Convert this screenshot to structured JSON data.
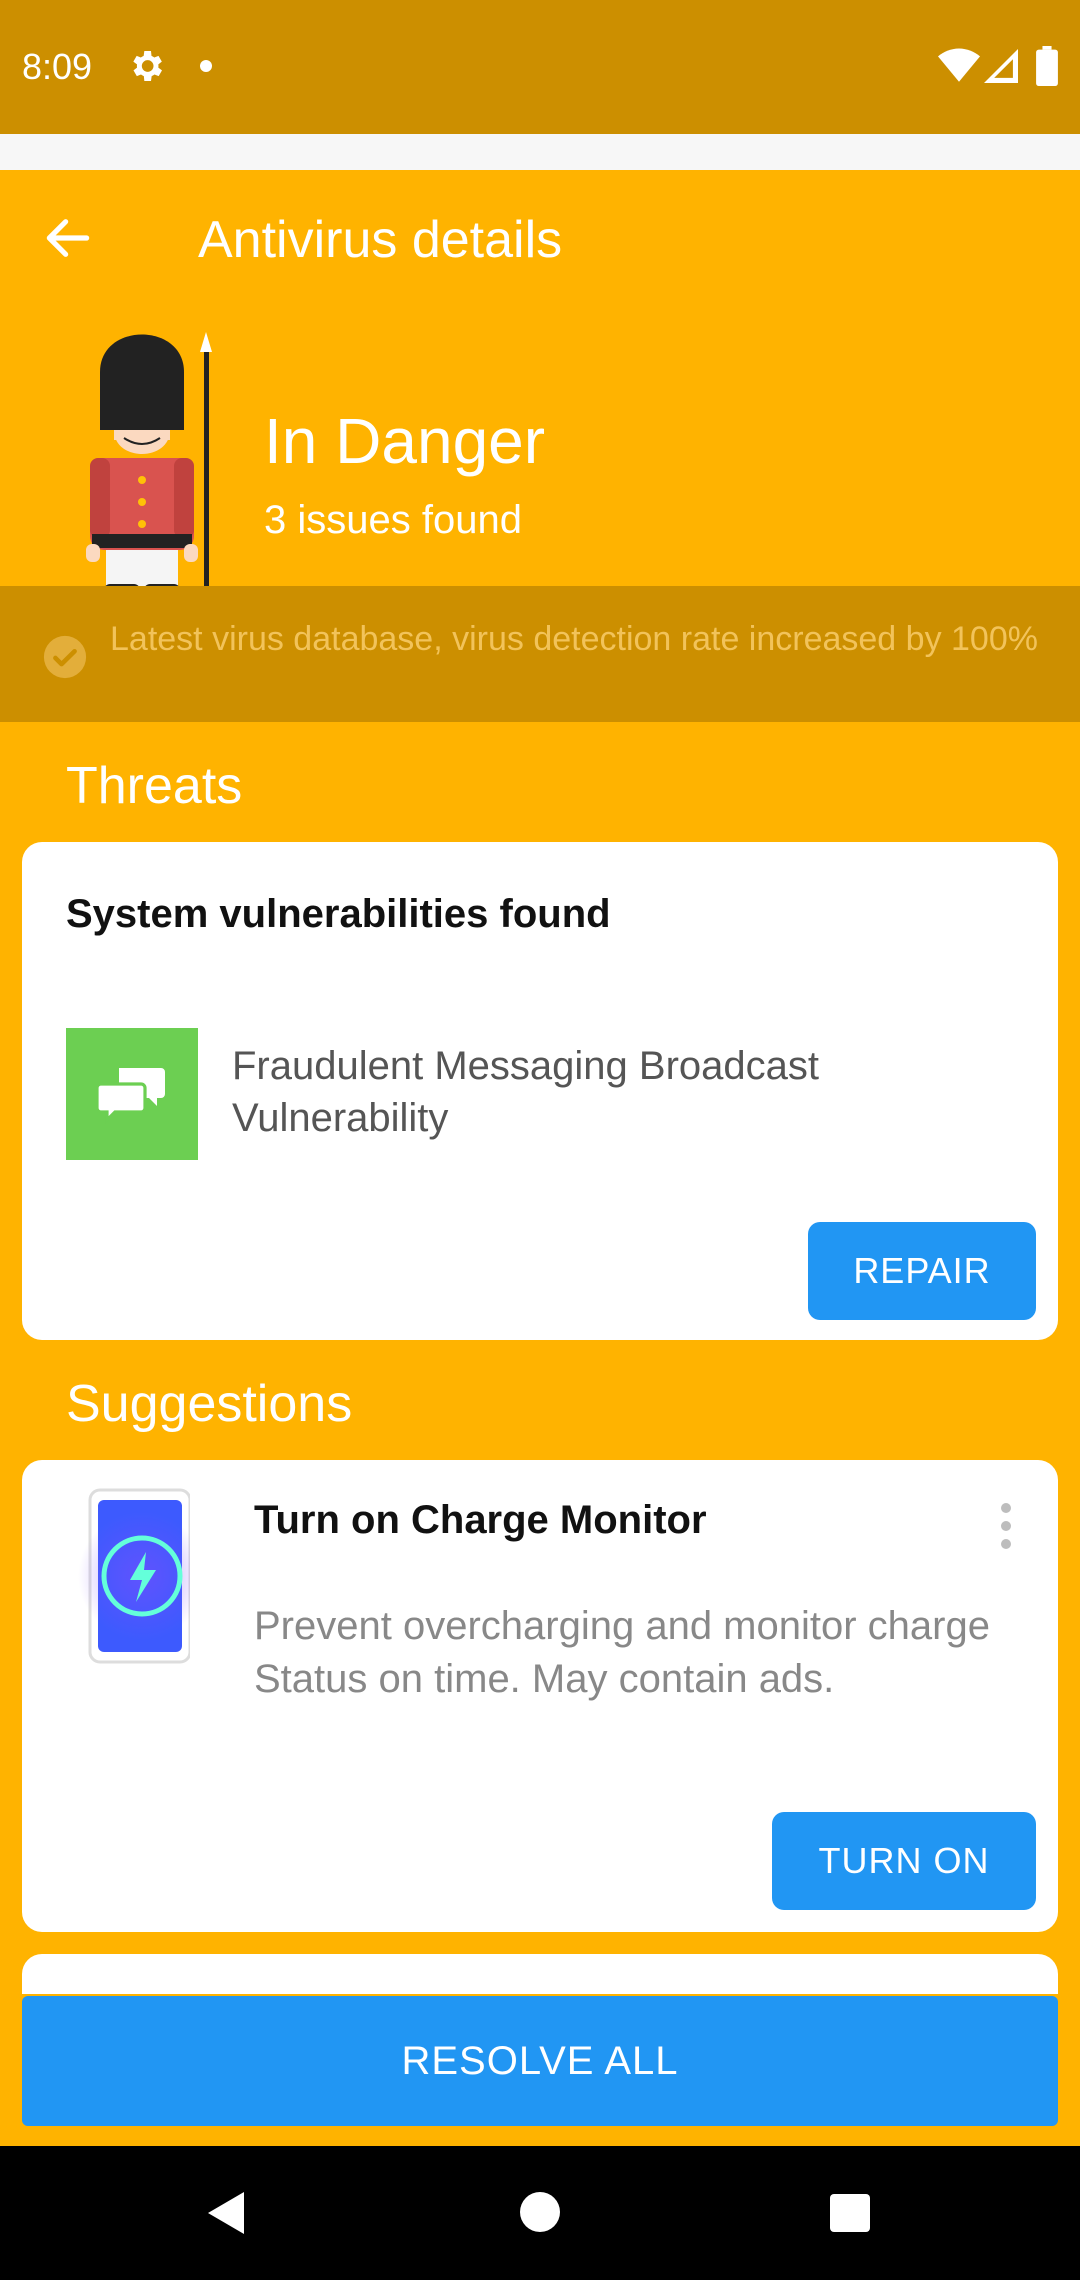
{
  "status_bar": {
    "time": "8:09",
    "icons": [
      "gear-icon",
      "notification-dot",
      "wifi-icon",
      "signal-icon",
      "battery-icon"
    ]
  },
  "app_bar": {
    "title": "Antivirus details",
    "back_icon": "arrow-left-icon"
  },
  "status": {
    "title": "In Danger",
    "subtitle": "3 issues found"
  },
  "db_banner": {
    "text": "Latest virus database, virus detection rate increased by 100%"
  },
  "threats": {
    "section_title": "Threats",
    "card_title": "System vulnerabilities found",
    "item_text": "Fraudulent Messaging Broadcast Vulnerability",
    "button_label": "REPAIR"
  },
  "suggestions": {
    "section_title": "Suggestions",
    "card_title": "Turn on Charge Monitor",
    "description": "Prevent overcharging and monitor charge Status on time. May contain ads.",
    "button_label": "TURN ON"
  },
  "resolve_all_label": "RESOLVE ALL",
  "colors": {
    "background": "#FFB300",
    "status_bar": "#CC8F00",
    "accent_button": "#2196F3",
    "threat_icon_bg": "#6CCF52"
  }
}
